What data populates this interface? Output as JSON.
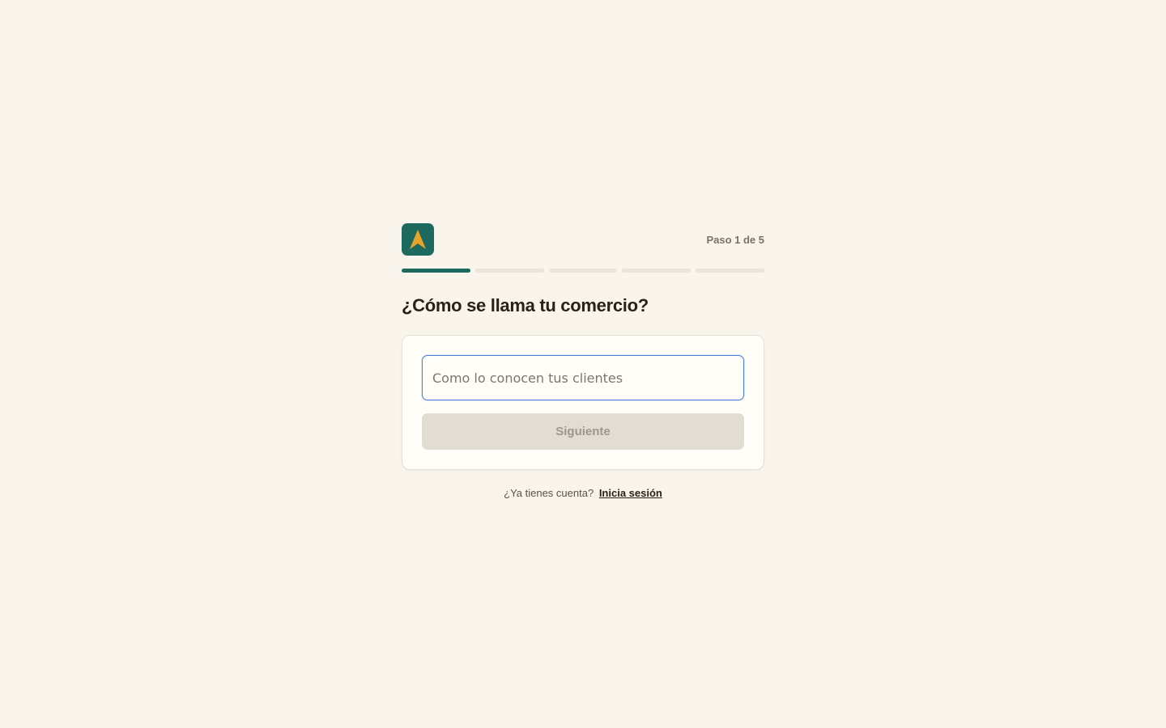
{
  "header": {
    "logo_icon": "arrow-up-icon",
    "step_label": "Paso 1 de 5"
  },
  "progress": {
    "current_step": 1,
    "total_steps": 5,
    "active_color": "#1f6a5e",
    "inactive_color": "#ebe5d9"
  },
  "question": {
    "title": "¿Cómo se llama tu comercio?"
  },
  "form": {
    "name_value": "",
    "name_placeholder": "Como lo conocen tus clientes",
    "next_label": "Siguiente"
  },
  "footer": {
    "prompt": "¿Ya tienes cuenta?",
    "login_link": "Inicia sesión"
  },
  "colors": {
    "background": "#f9f5ec",
    "brand": "#1f6a5e",
    "accent": "#e8a52a",
    "focus": "#4a7fd8"
  }
}
